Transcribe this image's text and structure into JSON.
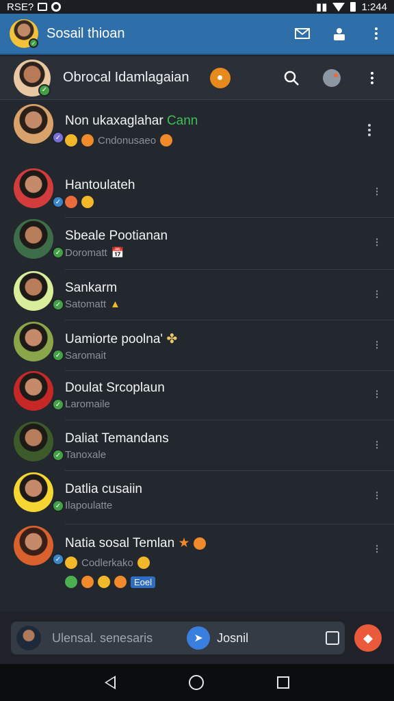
{
  "status_bar": {
    "left_text": "RSE?",
    "time": "1:244"
  },
  "app_bar": {
    "title": "Sosail thioan",
    "avatar_icon": "user-avatar"
  },
  "conversation_header": {
    "name": "Obrocal Idamlagaian"
  },
  "contacts": [
    {
      "name": "Non ukaxaglahar",
      "name_extra": "Cann",
      "subtitle": "Cndonusaeo"
    },
    {
      "name": "Hantoulateh",
      "subtitle": ""
    },
    {
      "name": "Sbeale Pootianan",
      "subtitle": "Doromatt"
    },
    {
      "name": "Sankarm",
      "subtitle": "Satomatt"
    },
    {
      "name": "Uamiorte poolna'",
      "subtitle": "Saromait"
    },
    {
      "name": "Doulat Srcoplaun",
      "subtitle": "Laromaile"
    },
    {
      "name": "Daliat Temandans",
      "subtitle": "Tanoxale"
    },
    {
      "name": "Datlia cusaiin",
      "subtitle": "Ilapoulatte"
    },
    {
      "name": "Natia sosal Temlan",
      "subtitle": "Codlerkako",
      "tag": "Eoel"
    }
  ],
  "composer": {
    "placeholder": "Ulensal. senesaris",
    "action_label": "Josnil"
  },
  "colors": {
    "app_bar": "#2f6fa9",
    "background": "#23272e",
    "accent": "#ea5a3b",
    "online": "#43a047"
  }
}
